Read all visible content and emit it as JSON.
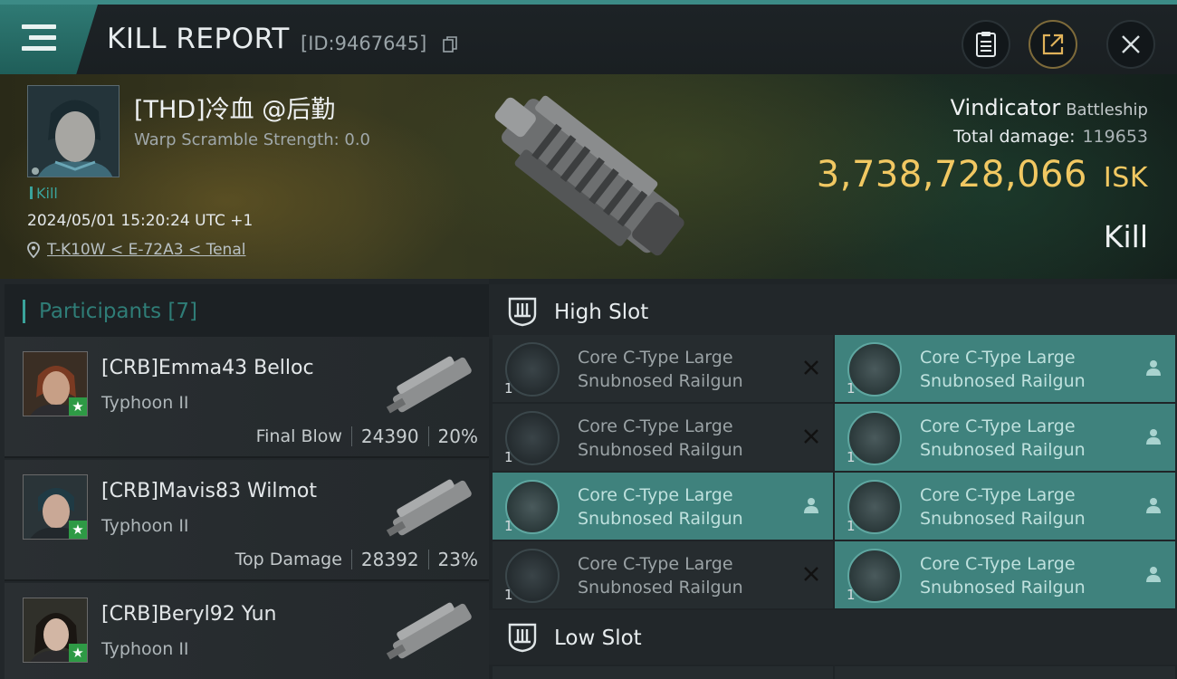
{
  "header": {
    "title": "KILL REPORT",
    "id_text": "[ID:9467645]"
  },
  "victim": {
    "name": "[THD]冷血 @后勤",
    "warp_scramble": "Warp Scramble Strength: 0.0",
    "kill_tag": "Kill",
    "datetime": "2024/05/01 15:20:24 UTC +1",
    "location": "T-K10W < E-72A3 < Tenal",
    "ship_name": "Vindicator",
    "ship_class": "Battleship",
    "total_damage_label": "Total damage:",
    "total_damage_value": "119653",
    "isk_value": "3,738,728,066",
    "isk_unit": "ISK",
    "result": "Kill"
  },
  "participants": {
    "title": "Participants",
    "count": "[7]",
    "items": [
      {
        "name": "[CRB]Emma43 Belloc",
        "ship": "Typhoon II",
        "label": "Final Blow",
        "damage": "24390",
        "percent": "20%"
      },
      {
        "name": "[CRB]Mavis83 Wilmot",
        "ship": "Typhoon II",
        "label": "Top Damage",
        "damage": "28392",
        "percent": "23%"
      },
      {
        "name": "[CRB]Beryl92 Yun",
        "ship": "Typhoon II",
        "label": "",
        "damage": "",
        "percent": ""
      }
    ]
  },
  "slots": {
    "high_slot_title": "High Slot",
    "low_slot_title": "Low Slot",
    "high_modules": [
      {
        "line1": "Core C-Type Large",
        "line2": "Snubnosed Railgun",
        "qty": "1",
        "status": "destroyed"
      },
      {
        "line1": "Core C-Type Large",
        "line2": "Snubnosed Railgun",
        "qty": "1",
        "status": "dropped"
      },
      {
        "line1": "Core C-Type Large",
        "line2": "Snubnosed Railgun",
        "qty": "1",
        "status": "destroyed"
      },
      {
        "line1": "Core C-Type Large",
        "line2": "Snubnosed Railgun",
        "qty": "1",
        "status": "dropped"
      },
      {
        "line1": "Core C-Type Large",
        "line2": "Snubnosed Railgun",
        "qty": "1",
        "status": "dropped"
      },
      {
        "line1": "Core C-Type Large",
        "line2": "Snubnosed Railgun",
        "qty": "1",
        "status": "dropped"
      },
      {
        "line1": "Core C-Type Large",
        "line2": "Snubnosed Railgun",
        "qty": "1",
        "status": "destroyed"
      },
      {
        "line1": "Core C-Type Large",
        "line2": "Snubnosed Railgun",
        "qty": "1",
        "status": "dropped"
      }
    ]
  },
  "colors": {
    "accent": "#3aa39b",
    "isk": "#f1c862",
    "fitted_bg": "#3f827d"
  }
}
